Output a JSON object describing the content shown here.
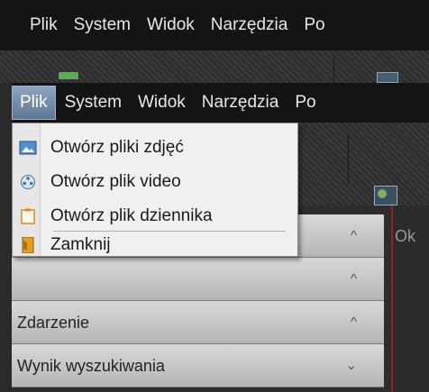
{
  "background_menu": {
    "items": [
      "Plik",
      "System",
      "Widok",
      "Narzędzia",
      "Po"
    ]
  },
  "menubar": {
    "items": [
      "Plik",
      "System",
      "Widok",
      "Narzędzia",
      "Po"
    ],
    "active": "Plik"
  },
  "dropdown": {
    "items": [
      {
        "label": "Otwórz pliki zdjęć",
        "icon": "image-file-icon"
      },
      {
        "label": "Otwórz plik video",
        "icon": "film-reel-icon"
      },
      {
        "label": "Otwórz plik dziennika",
        "icon": "clipboard-icon"
      },
      {
        "label": "Zamknij",
        "icon": "exit-door-icon"
      }
    ]
  },
  "panel": {
    "rows": [
      {
        "label": "",
        "chevron": "^"
      },
      {
        "label": "",
        "chevron": "^"
      },
      {
        "label": "Zdarzenie",
        "chevron": "^"
      },
      {
        "label": "Wynik wyszukiwania",
        "chevron": "v"
      }
    ]
  },
  "right_pane": {
    "label": "Ok"
  },
  "colors": {
    "menubar_bg": "#141414",
    "menu_active": "#6f87a3",
    "right_pane_border": "#8a2626"
  }
}
